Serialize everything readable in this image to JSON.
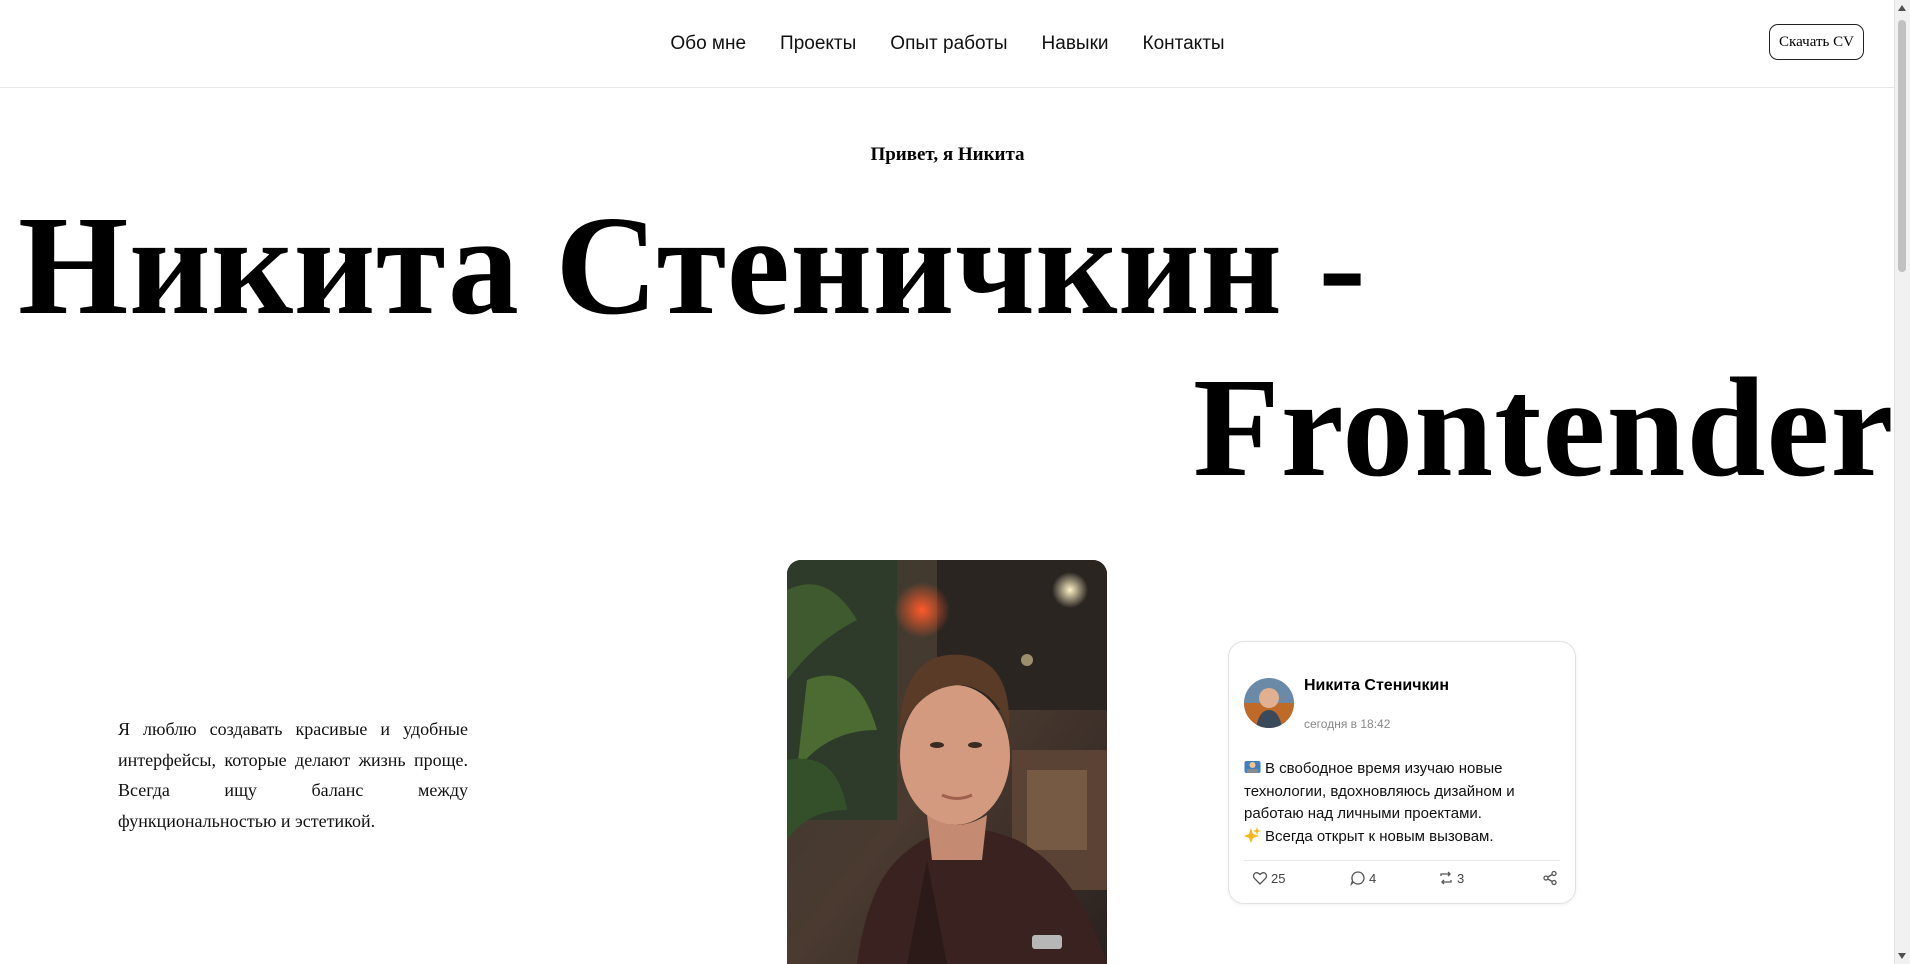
{
  "nav": {
    "items": [
      "Обо мне",
      "Проекты",
      "Опыт работы",
      "Навыки",
      "Контакты"
    ],
    "cv_button": "Скачать CV"
  },
  "hero": {
    "greeting": "Привет, я Никита",
    "title_line1": "Никита Стеничкин -",
    "title_line2": "Frontender"
  },
  "about": {
    "text": "Я люблю создавать красивые и удобные интерфейсы, которые делают жизнь проще. Всегда ищу баланс между функциональностью и эстетикой."
  },
  "post": {
    "author": "Никита Стеничкин",
    "time": "сегодня в 18:42",
    "line1": "В свободное время изучаю новые технологии, вдохновляюсь дизайном и работаю над личными проектами.",
    "line2": "Всегда открыт к новым вызовам.",
    "likes": "25",
    "comments": "4",
    "reposts": "3",
    "icons": [
      "heart-icon",
      "comment-icon",
      "repost-icon",
      "share-icon"
    ]
  }
}
